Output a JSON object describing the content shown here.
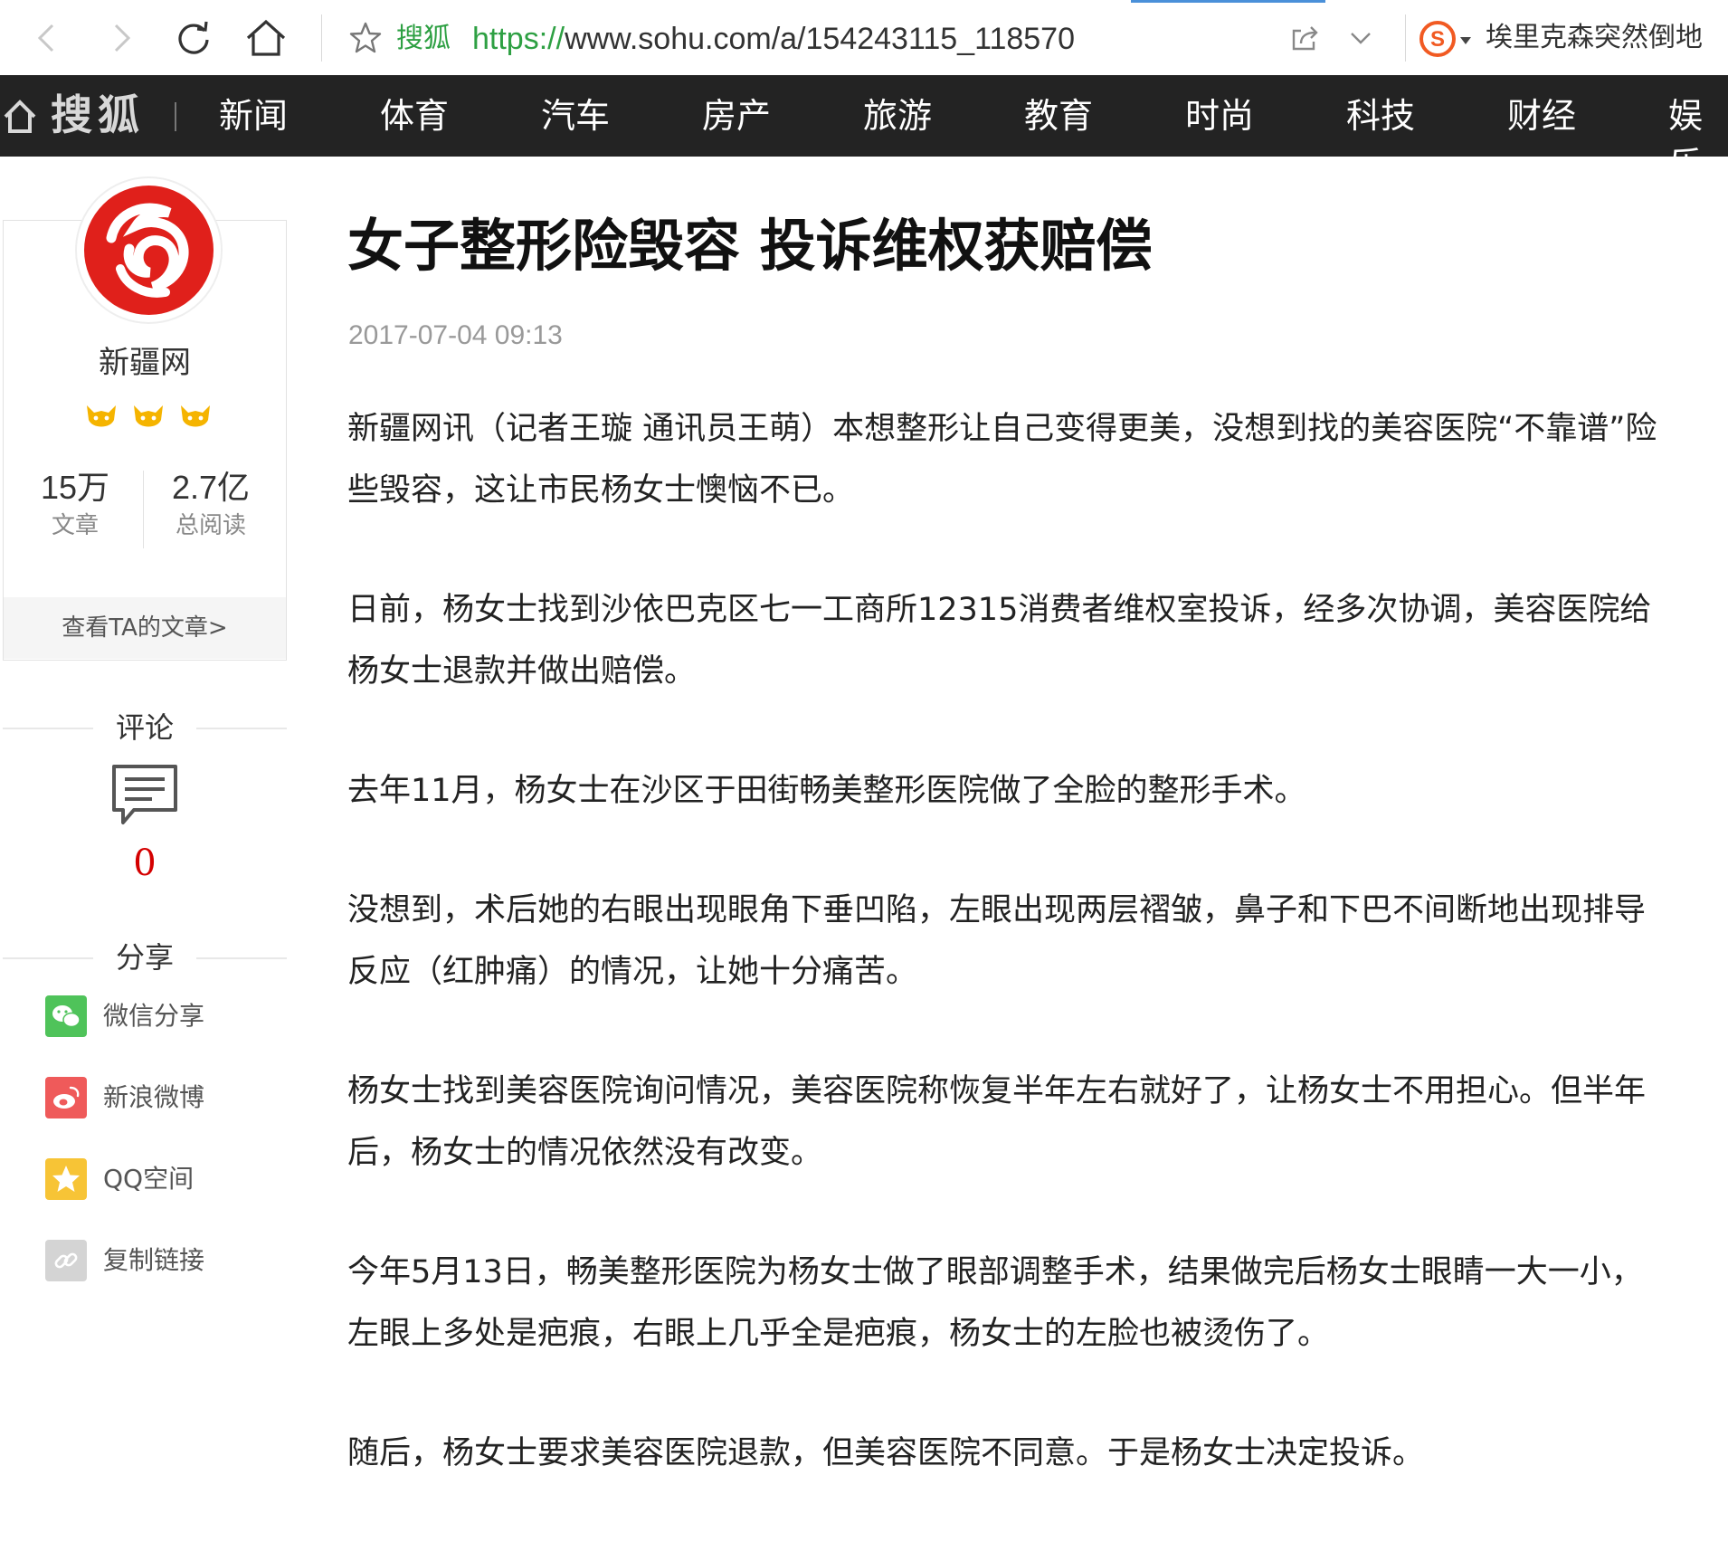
{
  "browser": {
    "site_name": "搜狐",
    "url_protocol": "https://",
    "url_rest": "www.sohu.com/a/154243115_118570",
    "search_suggestion": "埃里克森突然倒地",
    "icons": [
      "back-icon",
      "forward-icon",
      "refresh-icon",
      "home-icon",
      "star-icon",
      "share-icon",
      "dropdown-icon",
      "sogou-icon"
    ]
  },
  "channel_nav": {
    "logo": "搜狐",
    "items": [
      "新闻",
      "体育",
      "汽车",
      "房产",
      "旅游",
      "教育",
      "时尚",
      "科技",
      "财经",
      "娱乐"
    ]
  },
  "author": {
    "name": "新疆网",
    "articles_count": "15万",
    "articles_label": "文章",
    "reads_count": "2.7亿",
    "reads_label": "总阅读",
    "view_articles": "查看TA的文章>"
  },
  "comments": {
    "heading": "评论",
    "count": "0"
  },
  "share": {
    "heading": "分享",
    "items": [
      {
        "label": "微信分享",
        "icon": "wechat-icon",
        "color": "#4fc35a"
      },
      {
        "label": "新浪微博",
        "icon": "weibo-icon",
        "color": "#ef5a5a"
      },
      {
        "label": "QQ空间",
        "icon": "qzone-icon",
        "color": "#f7c436"
      },
      {
        "label": "复制链接",
        "icon": "link-icon",
        "color": "#d4d4d4"
      }
    ]
  },
  "article": {
    "title": "女子整形险毁容 投诉维权获赔偿",
    "date": "2017-07-04 09:13",
    "paragraphs": [
      "新疆网讯（记者王璇 通讯员王萌）本想整形让自己变得更美，没想到找的美容医院“不靠谱”险些毁容，这让市民杨女士懊恼不已。",
      "日前，杨女士找到沙依巴克区七一工商所12315消费者维权室投诉，经多次协调，美容医院给杨女士退款并做出赔偿。",
      "去年11月，杨女士在沙区于田街畅美整形医院做了全脸的整形手术。",
      "没想到，术后她的右眼出现眼角下垂凹陷，左眼出现两层褶皱，鼻子和下巴不间断地出现排导反应（红肿痛）的情况，让她十分痛苦。",
      "杨女士找到美容医院询问情况，美容医院称恢复半年左右就好了，让杨女士不用担心。但半年后，杨女士的情况依然没有改变。",
      "今年5月13日，畅美整形医院为杨女士做了眼部调整手术，结果做完后杨女士眼睛一大一小，左眼上多处是疤痕，右眼上几乎全是疤痕，杨女士的左脸也被烫伤了。",
      "随后，杨女士要求美容医院退款，但美容医院不同意。于是杨女士决定投诉。"
    ]
  },
  "colors": {
    "accent_green": "#2ea043",
    "nav_bg": "#232323",
    "brand_red": "#e0201b",
    "comment_count": "#d40000"
  }
}
